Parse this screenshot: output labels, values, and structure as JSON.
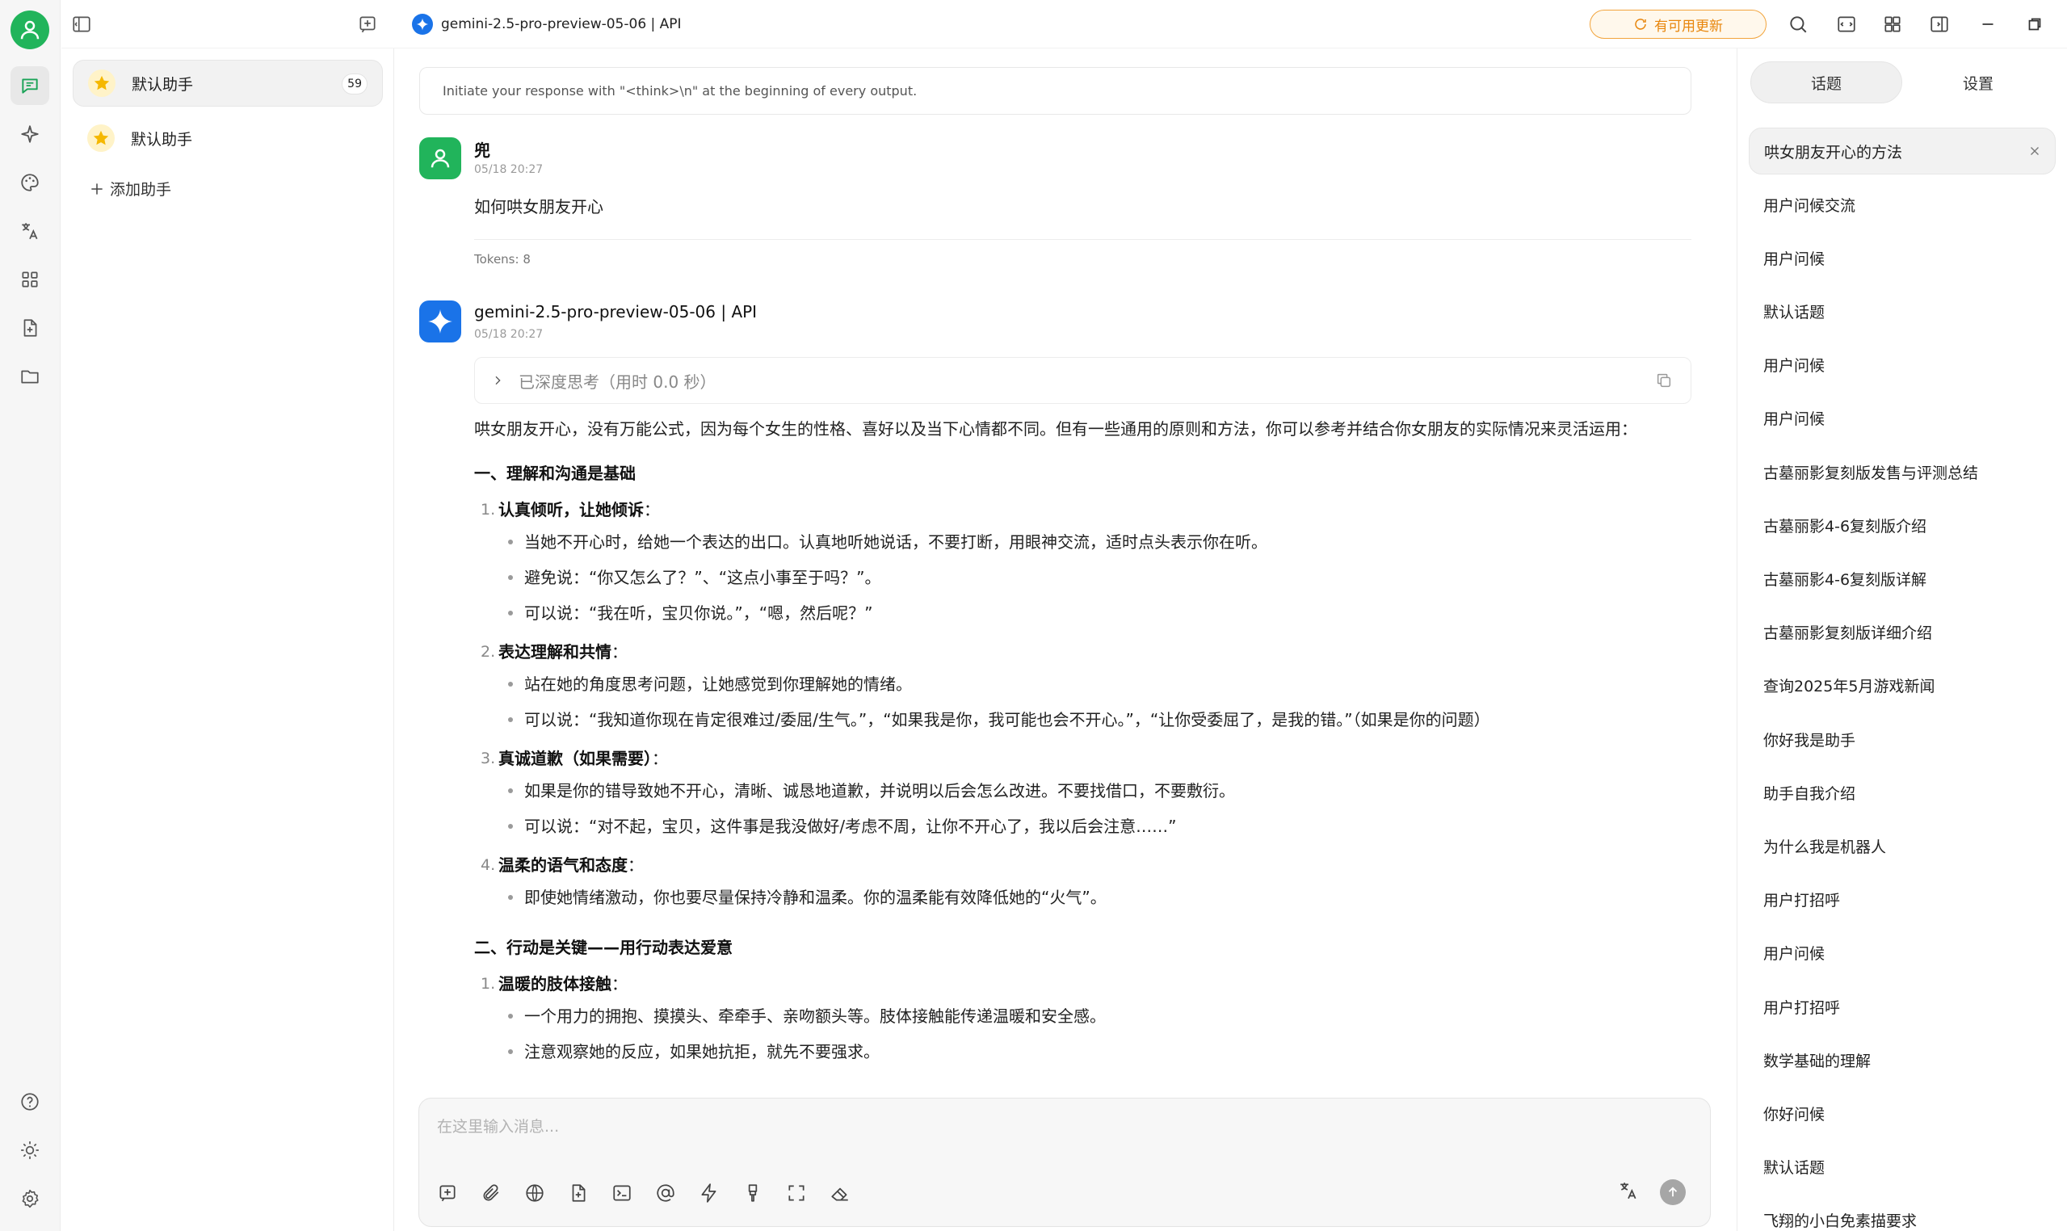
{
  "topbar": {
    "model_title": "gemini-2.5-pro-preview-05-06 | API",
    "update_label": "有可用更新",
    "accent": "#f2a43c"
  },
  "rail": {
    "items": [
      "chat-icon",
      "sparkle-icon",
      "palette-icon",
      "translate-icon",
      "apps-icon",
      "file-icon",
      "folder-icon"
    ],
    "bottom": [
      "help-icon",
      "sun-icon",
      "settings-icon"
    ],
    "brand_color": "#21b45b"
  },
  "assistants": {
    "items": [
      {
        "label": "默认助手",
        "count": "59"
      },
      {
        "label": "默认助手"
      }
    ],
    "add_label": "添加助手"
  },
  "chat": {
    "system_prompt": "Initiate your response with \"<think>\\n\" at the beginning of every output.",
    "user": {
      "name": "兜",
      "time": "05/18 20:27",
      "text": "如何哄女朋友开心",
      "tokens": "Tokens: 8"
    },
    "model": {
      "name": "gemini-2.5-pro-preview-05-06 | API",
      "time": "05/18 20:27",
      "thinking_label": "已深度思考（用时 0.0 秒）",
      "intro": "哄女朋友开心，没有万能公式，因为每个女生的性格、喜好以及当下心情都不同。但有一些通用的原则和方法，你可以参考并结合你女朋友的实际情况来灵活运用：",
      "sections": [
        {
          "title": "一、理解和沟通是基础",
          "items": [
            {
              "num": "1.",
              "title": "认真倾听，让她倾诉",
              "suffix": "：",
              "bullets": [
                "当她不开心时，给她一个表达的出口。认真地听她说话，不要打断，用眼神交流，适时点头表示你在听。",
                "避免说：“你又怎么了？”、“这点小事至于吗？”。",
                "可以说：“我在听，宝贝你说。”，“嗯，然后呢？”"
              ]
            },
            {
              "num": "2.",
              "title": "表达理解和共情",
              "suffix": "：",
              "bullets": [
                "站在她的角度思考问题，让她感觉到你理解她的情绪。",
                "可以说：“我知道你现在肯定很难过/委屈/生气。”，“如果我是你，我可能也会不开心。”，“让你受委屈了，是我的错。”（如果是你的问题）"
              ]
            },
            {
              "num": "3.",
              "title": "真诚道歉（如果需要）",
              "suffix": "：",
              "bullets": [
                "如果是你的错导致她不开心，清晰、诚恳地道歉，并说明以后会怎么改进。不要找借口，不要敷衍。",
                "可以说：“对不起，宝贝，这件事是我没做好/考虑不周，让你不开心了，我以后会注意……”"
              ]
            },
            {
              "num": "4.",
              "title": "温柔的语气和态度",
              "suffix": "：",
              "bullets": [
                "即使她情绪激动，你也要尽量保持冷静和温柔。你的温柔能有效降低她的“火气”。"
              ]
            }
          ]
        },
        {
          "title": "二、行动是关键——用行动表达爱意",
          "items": [
            {
              "num": "1.",
              "title": "温暖的肢体接触",
              "suffix": "：",
              "bullets": [
                "一个用力的拥抱、摸摸头、牵牵手、亲吻额头等。肢体接触能传递温暖和安全感。",
                "注意观察她的反应，如果她抗拒，就先不要强求。"
              ]
            }
          ]
        }
      ]
    },
    "input_placeholder": "在这里输入消息..."
  },
  "topics": {
    "tabs": [
      "话题",
      "设置"
    ],
    "items": [
      "哄女朋友开心的方法",
      "用户问候交流",
      "用户问候",
      "默认话题",
      "用户问候",
      "用户问候",
      "古墓丽影复刻版发售与评测总结",
      "古墓丽影4-6复刻版介绍",
      "古墓丽影4-6复刻版详解",
      "古墓丽影复刻版详细介绍",
      "查询2025年5月游戏新闻",
      "你好我是助手",
      "助手自我介绍",
      "为什么我是机器人",
      "用户打招呼",
      "用户问候",
      "用户打招呼",
      "数学基础的理解",
      "你好问候",
      "默认话题",
      "飞翔的小白免素描要求"
    ]
  }
}
